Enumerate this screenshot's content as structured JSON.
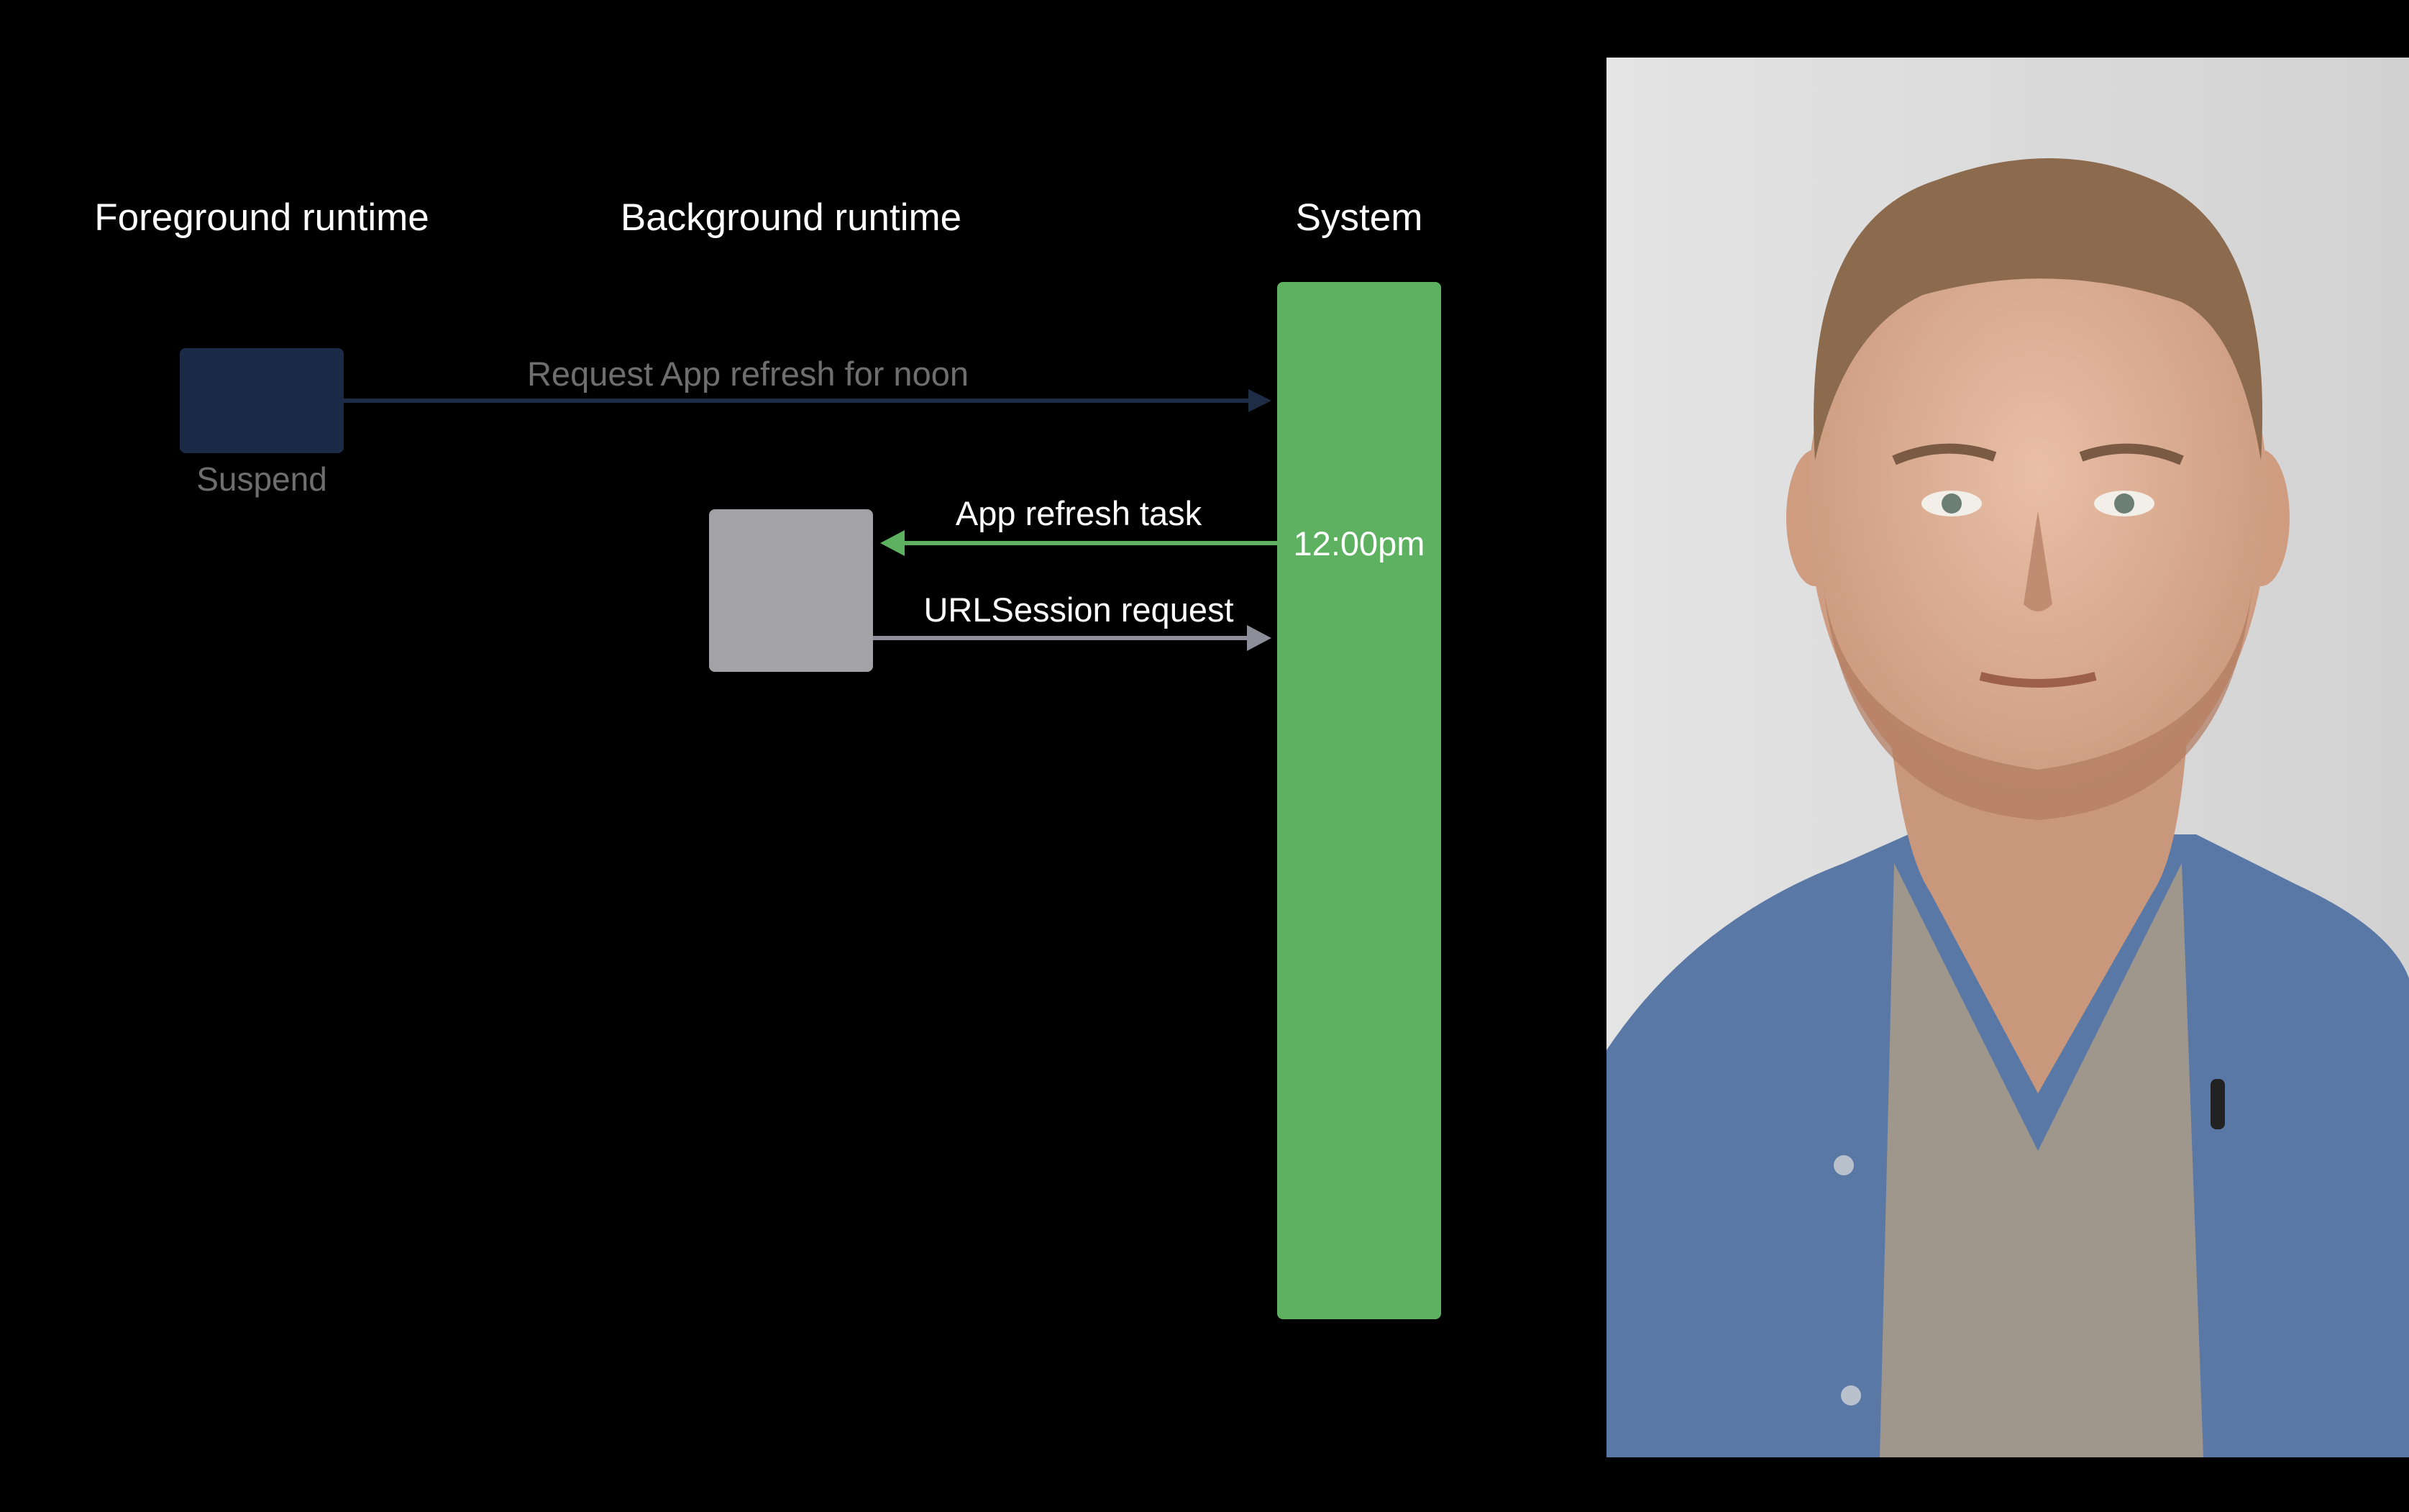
{
  "diagram": {
    "columns": {
      "foreground": "Foreground runtime",
      "background": "Background runtime",
      "system": "System"
    },
    "foreground_state_label": "Suspend",
    "messages": {
      "request": "Request App refresh for noon",
      "refresh_task": "App refresh task",
      "url_request": "URLSession request"
    },
    "system_time": "12:00pm"
  },
  "colors": {
    "background": "#000000",
    "system_bar": "#5eb161",
    "suspended_box": "#1a2a47",
    "background_box": "#a3a3a7",
    "dimmed_text": "#6e6e6e",
    "request_arrow": "#1e2c45",
    "refresh_arrow": "#5eb161",
    "url_arrow": "#8e8e9a"
  },
  "speaker": {
    "icon": "speaker-video-portrait"
  }
}
